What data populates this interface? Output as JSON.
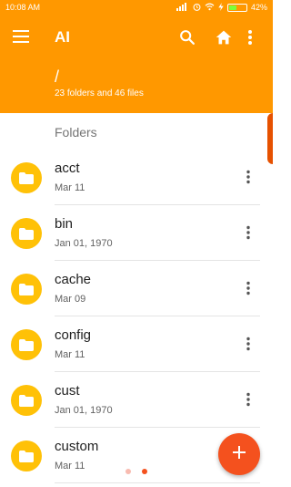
{
  "status_bar": {
    "time": "10:08 AM",
    "battery_text": "42%",
    "battery_level": 0.42
  },
  "toolbar": {
    "title": "AI"
  },
  "header": {
    "path": "/",
    "summary": "23 folders and 46 files"
  },
  "section": {
    "title": "Folders"
  },
  "folders": [
    {
      "name": "acct",
      "date": "Mar 11"
    },
    {
      "name": "bin",
      "date": "Jan 01, 1970"
    },
    {
      "name": "cache",
      "date": "Mar 09"
    },
    {
      "name": "config",
      "date": "Mar 11"
    },
    {
      "name": "cust",
      "date": "Jan 01, 1970"
    },
    {
      "name": "custom",
      "date": "Mar 11"
    }
  ],
  "page_indicator": {
    "count": 2,
    "active_index": 1
  },
  "colors": {
    "accent": "#FF9800",
    "fab": "#F4511E",
    "folder": "#FFC107",
    "scroll_handle": "#E65100"
  }
}
